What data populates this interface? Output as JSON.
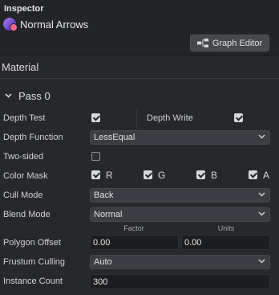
{
  "inspector": {
    "title": "Inspector"
  },
  "asset": {
    "name": "Normal Arrows",
    "icon": "material-sphere-icon"
  },
  "toolbar": {
    "graph_editor_label": "Graph Editor"
  },
  "section": {
    "title": "Material"
  },
  "pass": {
    "title": "Pass 0",
    "expanded": true
  },
  "depth": {
    "test_label": "Depth Test",
    "test_checked": true,
    "write_label": "Depth Write",
    "write_checked": true,
    "function_label": "Depth Function",
    "function_value": "LessEqual"
  },
  "two_sided": {
    "label": "Two-sided",
    "checked": false
  },
  "color_mask": {
    "label": "Color Mask",
    "channels": [
      {
        "name": "R",
        "checked": true
      },
      {
        "name": "G",
        "checked": true
      },
      {
        "name": "B",
        "checked": true
      },
      {
        "name": "A",
        "checked": true
      }
    ]
  },
  "cull_mode": {
    "label": "Cull Mode",
    "value": "Back"
  },
  "blend_mode": {
    "label": "Blend Mode",
    "value": "Normal"
  },
  "polygon_offset": {
    "label": "Polygon Offset",
    "factor_label": "Factor",
    "factor_value": "0.00",
    "units_label": "Units",
    "units_value": "0.00"
  },
  "frustum_culling": {
    "label": "Frustum Culling",
    "value": "Auto"
  },
  "instance_count": {
    "label": "Instance Count",
    "value": "300"
  }
}
